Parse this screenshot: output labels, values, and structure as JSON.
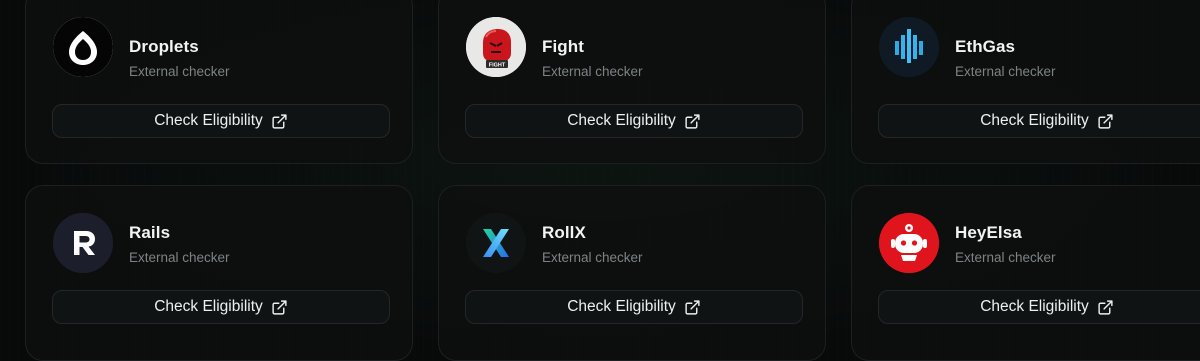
{
  "cards": [
    {
      "name": "Droplets",
      "subtitle": "External checker",
      "button": "Check Eligibility",
      "icon": "droplets-logo-icon",
      "logo_bg": "#ffffff"
    },
    {
      "name": "Fight",
      "subtitle": "External checker",
      "button": "Check Eligibility",
      "icon": "fight-logo-icon",
      "logo_bg": "#e8e8e6",
      "logo_text": "FIGHT"
    },
    {
      "name": "EthGas",
      "subtitle": "External checker",
      "button": "Check Eligibility",
      "icon": "ethgas-logo-icon",
      "logo_bg": "#0f1a24"
    },
    {
      "name": "Rails",
      "subtitle": "External checker",
      "button": "Check Eligibility",
      "icon": "rails-logo-icon",
      "logo_bg": "#1c1f2b"
    },
    {
      "name": "RollX",
      "subtitle": "External checker",
      "button": "Check Eligibility",
      "icon": "rollx-logo-icon",
      "logo_bg": "#101414"
    },
    {
      "name": "HeyElsa",
      "subtitle": "External checker",
      "button": "Check Eligibility",
      "icon": "heyelsa-logo-icon",
      "logo_bg": "#e0141d"
    }
  ],
  "colors": {
    "background": "#080a0a",
    "card_border": "#1c2020",
    "text": "#f2f4f4",
    "muted": "#7d8383"
  }
}
